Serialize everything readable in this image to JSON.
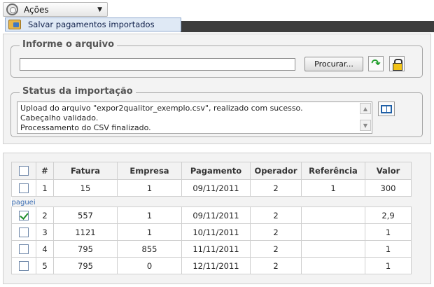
{
  "toolbar": {
    "actions_label": "Ações",
    "menu_item_label": "Salvar pagamentos importados"
  },
  "file_section": {
    "legend": "Informe o arquivo",
    "file_value": "",
    "browse_label": "Procurar..."
  },
  "status_section": {
    "legend": "Status da importação",
    "lines": [
      "Upload do arquivo \"expor2qualitor_exemplo.csv\", realizado com sucesso.",
      "Cabeçalho validado.",
      "Processamento do CSV finalizado."
    ]
  },
  "table": {
    "headers": [
      "#",
      "Fatura",
      "Empresa",
      "Pagamento",
      "Operador",
      "Referência",
      "Valor"
    ],
    "group_label": "paguei",
    "rows": [
      {
        "checked": false,
        "num": "1",
        "fatura": "15",
        "empresa": "1",
        "pagamento": "09/11/2011",
        "operador": "2",
        "referencia": "1",
        "valor": "300"
      },
      {
        "checked": true,
        "num": "2",
        "fatura": "557",
        "empresa": "1",
        "pagamento": "09/11/2011",
        "operador": "2",
        "referencia": "",
        "valor": "2,9"
      },
      {
        "checked": false,
        "num": "3",
        "fatura": "1121",
        "empresa": "1",
        "pagamento": "10/11/2011",
        "operador": "2",
        "referencia": "",
        "valor": "1"
      },
      {
        "checked": false,
        "num": "4",
        "fatura": "795",
        "empresa": "855",
        "pagamento": "11/11/2011",
        "operador": "2",
        "referencia": "",
        "valor": "1"
      },
      {
        "checked": false,
        "num": "5",
        "fatura": "795",
        "empresa": "0",
        "pagamento": "12/11/2011",
        "operador": "2",
        "referencia": "",
        "valor": "1"
      }
    ]
  },
  "icons": {
    "actions": "gear-icon",
    "menu_item": "save-import-icon",
    "refresh": "green-arrow-icon",
    "lock": "lock-icon",
    "log": "book-icon"
  }
}
